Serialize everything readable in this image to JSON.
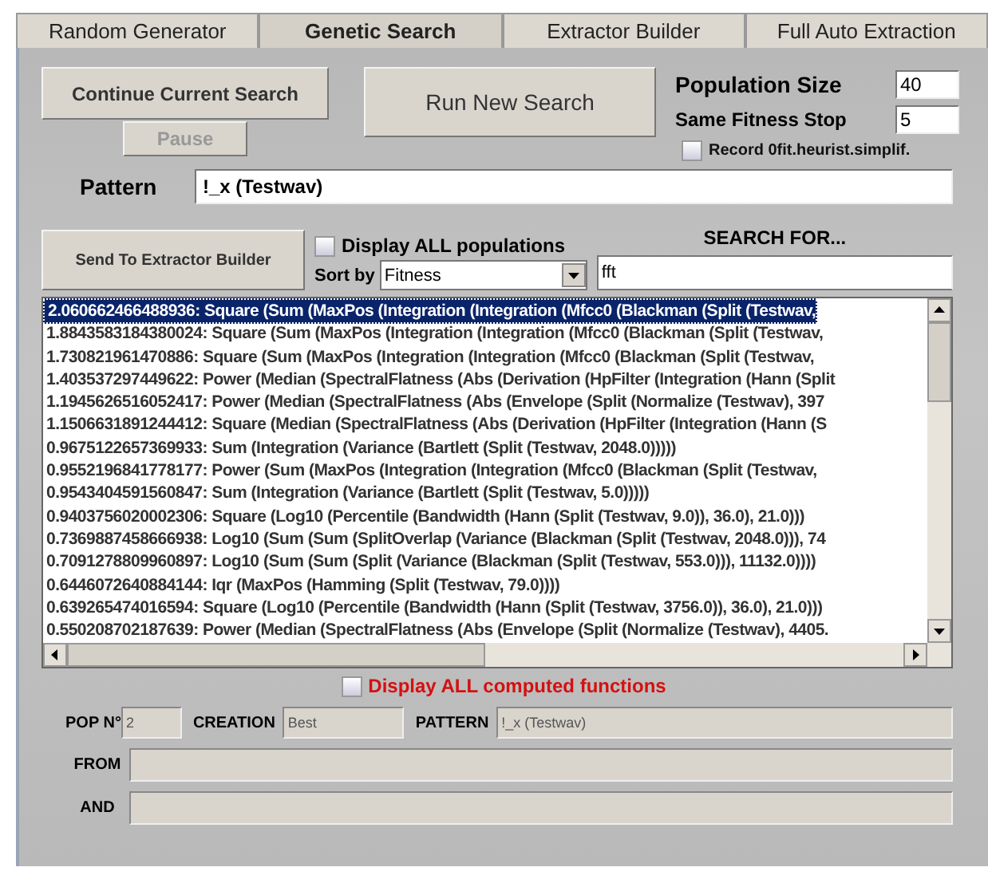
{
  "tabs": [
    {
      "label": "Random Generator",
      "selected": false
    },
    {
      "label": "Genetic Search",
      "selected": true
    },
    {
      "label": "Extractor Builder",
      "selected": false
    },
    {
      "label": "Full Auto Extraction",
      "selected": false
    }
  ],
  "continue_button": {
    "label": "Continue Current Search",
    "disabled": false
  },
  "pause_button": {
    "label": "Pause",
    "disabled": true
  },
  "run_button": {
    "label": "Run New Search"
  },
  "population_size": {
    "label": "Population Size",
    "value": "40"
  },
  "same_fitness_stop": {
    "label": "Same Fitness Stop",
    "value": "5"
  },
  "record_option": {
    "label": "Record 0fit.heurist.simplif.",
    "checked": false
  },
  "pattern": {
    "label": "Pattern",
    "value": "!_x (Testwav)"
  },
  "send_button": {
    "label": "Send To Extractor Builder"
  },
  "display_all_populations": {
    "label": "Display ALL populations",
    "checked": false
  },
  "sort_by": {
    "label": "Sort by",
    "value": "Fitness"
  },
  "search_for": {
    "label": "SEARCH FOR...",
    "value": "fft"
  },
  "results": [
    {
      "text": "2.060662466488936: Square (Sum (MaxPos (Integration (Integration (Mfcc0 (Blackman (Split (Testwav,",
      "selected": true
    },
    {
      "text": "1.8843583184380024: Square (Sum (MaxPos (Integration (Integration (Mfcc0 (Blackman (Split (Testwav,",
      "selected": false
    },
    {
      "text": "1.730821961470886: Square (Sum (MaxPos (Integration (Integration (Mfcc0 (Blackman (Split (Testwav,",
      "selected": false
    },
    {
      "text": "1.403537297449622: Power (Median (SpectralFlatness (Abs (Derivation (HpFilter (Integration (Hann (Split",
      "selected": false
    },
    {
      "text": "1.1945626516052417: Power (Median (SpectralFlatness (Abs (Envelope (Split (Normalize (Testwav), 397",
      "selected": false
    },
    {
      "text": "1.1506631891244412: Square (Median (SpectralFlatness (Abs (Derivation (HpFilter (Integration (Hann (S",
      "selected": false
    },
    {
      "text": "0.9675122657369933: Sum (Integration (Variance (Bartlett (Split (Testwav, 2048.0)))))",
      "selected": false
    },
    {
      "text": "0.9552196841778177: Power (Sum (MaxPos (Integration (Integration (Mfcc0 (Blackman (Split (Testwav,",
      "selected": false
    },
    {
      "text": "0.9543404591560847: Sum (Integration (Variance (Bartlett (Split (Testwav, 5.0)))))",
      "selected": false
    },
    {
      "text": "0.9403756020002306: Square (Log10 (Percentile (Bandwidth (Hann (Split (Testwav, 9.0)), 36.0), 21.0)))",
      "selected": false
    },
    {
      "text": "0.7369887458666938: Log10 (Sum (Sum (SplitOverlap (Variance (Blackman (Split (Testwav, 2048.0))), 74",
      "selected": false
    },
    {
      "text": "0.7091278809960897: Log10 (Sum (Sum (Split (Variance (Blackman (Split (Testwav, 553.0))), 11132.0))))",
      "selected": false
    },
    {
      "text": "0.6446072640884144: Iqr (MaxPos (Hamming (Split (Testwav, 79.0))))",
      "selected": false
    },
    {
      "text": "0.639265474016594: Square (Log10 (Percentile (Bandwidth (Hann (Split (Testwav, 3756.0)), 36.0), 21.0)))",
      "selected": false
    },
    {
      "text": "0.550208702187639: Power (Median (SpectralFlatness (Abs (Envelope (Split (Normalize (Testwav), 4405.",
      "selected": false
    }
  ],
  "display_all_computed": {
    "label": "Display ALL computed functions",
    "checked": false
  },
  "pop_number": {
    "label": "POP N°",
    "value": "2"
  },
  "creation": {
    "label": "CREATION",
    "value": "Best"
  },
  "pattern_info": {
    "label": "PATTERN",
    "value": "!_x (Testwav)"
  },
  "from": {
    "label": "FROM"
  },
  "and": {
    "label": "AND"
  }
}
